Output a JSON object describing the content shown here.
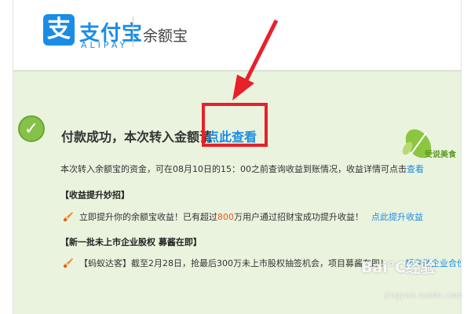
{
  "header": {
    "logo_glyph": "支",
    "logo_cn": "支付宝",
    "logo_en": "ALIPAY",
    "product": "余额宝"
  },
  "success": {
    "message": "付款成功，本次转入金额请",
    "link": "点此查看"
  },
  "badge": {
    "text": "受说美食"
  },
  "description": {
    "text": "本次转入余额宝的资金，可在08月10日的15：00之前查询收益到账情况，收益详情可点击",
    "link": "查看"
  },
  "promo1": {
    "title": "【收益提升妙招】",
    "text_before": "立即提升你的余额宝收益！已有超过",
    "highlight": "800",
    "text_after": "万用户通过招财宝成功提升收益！",
    "link": "点此提升收益"
  },
  "promo2": {
    "title": "【新一批未上市企业股权 募酱在即】",
    "text": "【蚂蚁达客】截至2月28日，抢最后300万未上市股权抽签机会，项目募酱在即！",
    "link": "一起专做企业合伙人"
  },
  "watermark": {
    "main": "Bai℃经验",
    "sub": "jingyan.baidu.com"
  },
  "colors": {
    "brand_blue": "#1b8ce6",
    "annotation_red": "#e8202a",
    "band_green": "#eaf3de",
    "highlight_orange": "#e8591a"
  },
  "icons": [
    "check-circle-icon",
    "rocket-icon",
    "leaf-icon",
    "annotation-arrow"
  ]
}
